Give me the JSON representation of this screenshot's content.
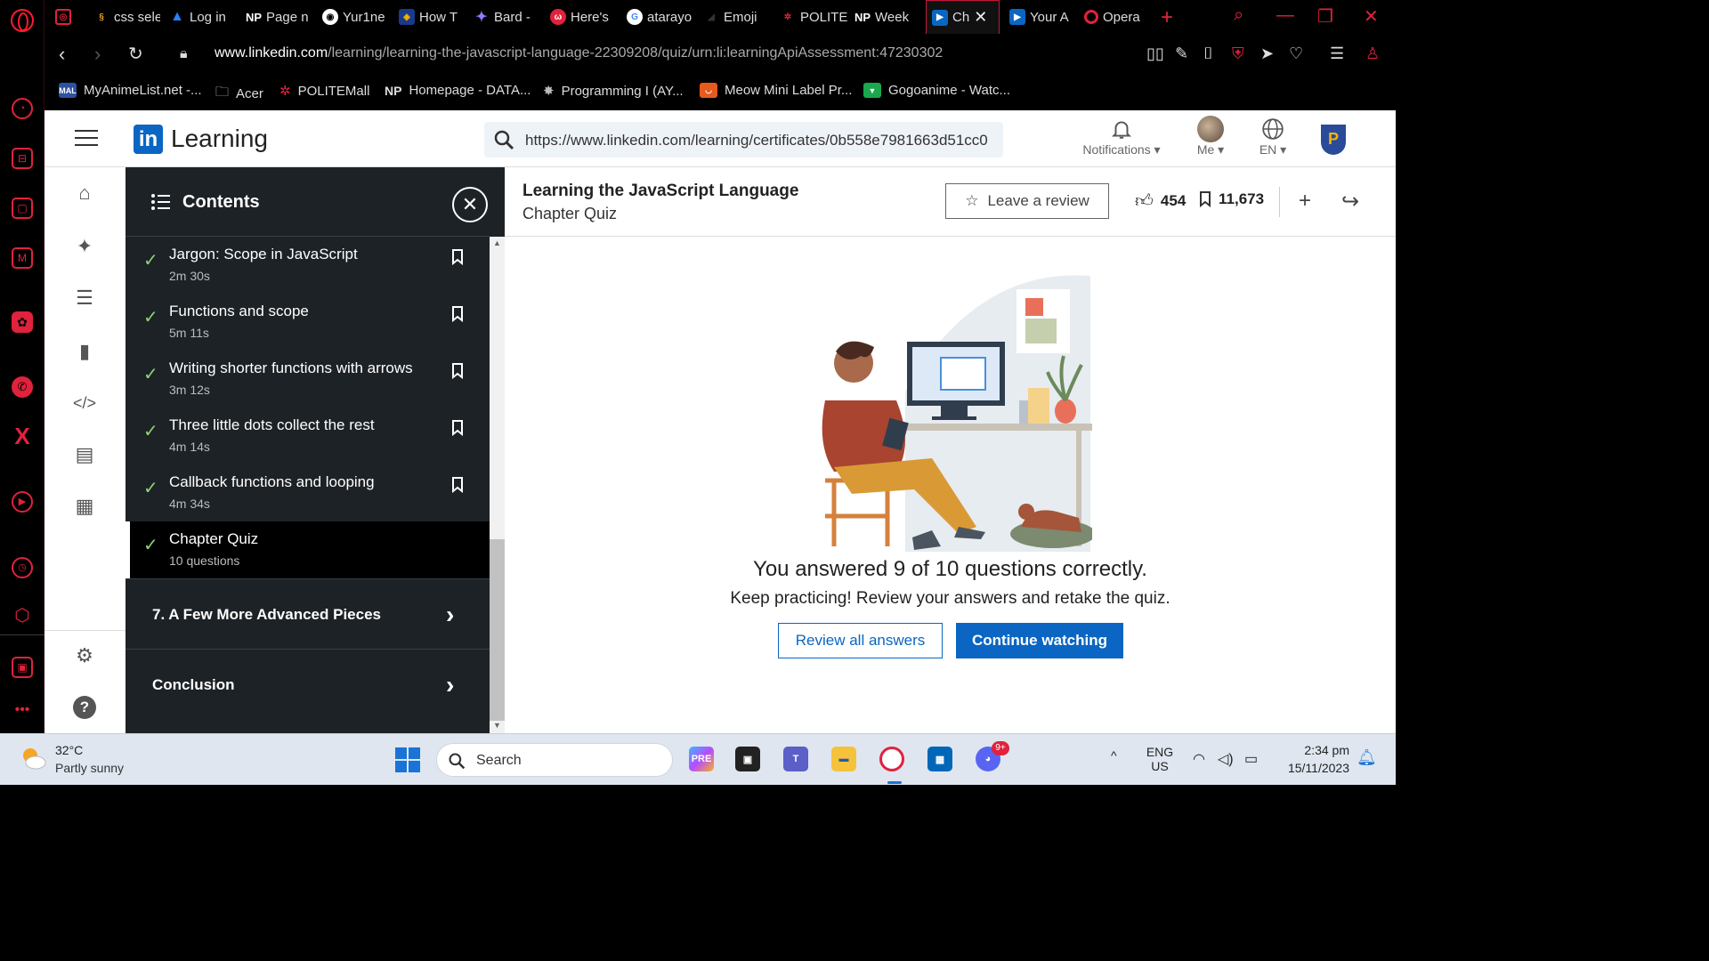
{
  "browser": {
    "tabs": [
      {
        "label": "css sele",
        "icon": "code-icon"
      },
      {
        "label": "Log in",
        "icon": "atlassian-icon"
      },
      {
        "label": "Page n",
        "icon": "notion-icon"
      },
      {
        "label": "Yur1ne",
        "icon": "globe-icon"
      },
      {
        "label": "How T",
        "icon": "shield-icon"
      },
      {
        "label": "Bard -",
        "icon": "bard-icon"
      },
      {
        "label": "Here's",
        "icon": "app-icon"
      },
      {
        "label": "atarayo",
        "icon": "google-icon"
      },
      {
        "label": "Emoji",
        "icon": "emoji-icon"
      },
      {
        "label": "POLITE",
        "icon": "polite-icon"
      },
      {
        "label": "Week",
        "icon": "notion-icon"
      },
      {
        "label": "Ch",
        "icon": "linkedin-learning-icon"
      },
      {
        "label": "Your A",
        "icon": "linkedin-learning-icon"
      },
      {
        "label": "Opera",
        "icon": "opera-icon"
      }
    ],
    "url_host": "www.linkedin.com",
    "url_path": "/learning/learning-the-javascript-language-22309208/quiz/urn:li:learningApiAssessment:47230302",
    "bookmarks": [
      {
        "label": "MyAnimeList.net -...",
        "badge": "MAL"
      },
      {
        "label": "Acer",
        "badge": ""
      },
      {
        "label": "POLITEMall",
        "badge": ""
      },
      {
        "label": "Homepage - DATA...",
        "badge": "NP"
      },
      {
        "label": "Programming I (AY...",
        "badge": ""
      },
      {
        "label": "Meow Mini Label Pr...",
        "badge": ""
      },
      {
        "label": "Gogoanime - Watc...",
        "badge": ""
      }
    ]
  },
  "header": {
    "brand": "Learning",
    "logo_text": "in",
    "search_value": "https://www.linkedin.com/learning/certificates/0b558e7981663d51cc0",
    "notifications_label": "Notifications",
    "me_label": "Me",
    "lang_label": "EN",
    "org_logo_text": "P"
  },
  "contents": {
    "title": "Contents",
    "items": [
      {
        "title": "Jargon: Scope in JavaScript",
        "duration": "2m 30s"
      },
      {
        "title": "Functions and scope",
        "duration": "5m 11s"
      },
      {
        "title": "Writing shorter functions with arrows",
        "duration": "3m 12s"
      },
      {
        "title": "Three little dots collect the rest",
        "duration": "4m 14s"
      },
      {
        "title": "Callback functions and looping",
        "duration": "4m 34s"
      }
    ],
    "current": {
      "title": "Chapter Quiz",
      "duration": "10 questions"
    },
    "sections": [
      {
        "title": "7. A Few More Advanced Pieces"
      },
      {
        "title": "Conclusion"
      }
    ]
  },
  "course": {
    "title": "Learning the JavaScript Language",
    "subtitle": "Chapter Quiz",
    "review_label": "Leave a review",
    "likes": "454",
    "saves": "11,673"
  },
  "quiz": {
    "result": "You answered 9 of 10 questions correctly.",
    "hint": "Keep practicing! Review your answers and retake the quiz.",
    "review_button": "Review all answers",
    "continue_button": "Continue watching"
  },
  "taskbar": {
    "temperature": "32°C",
    "weather": "Partly sunny",
    "search_label": "Search",
    "discord_badge": "9+",
    "lang_top": "ENG",
    "lang_bottom": "US",
    "time": "2:34 pm",
    "date": "15/11/2023"
  },
  "colors": {
    "linkedin_blue": "#0a66c2",
    "opera_red": "#e0223d",
    "panel_dark": "#1d2226",
    "check_green": "#8fd174"
  }
}
